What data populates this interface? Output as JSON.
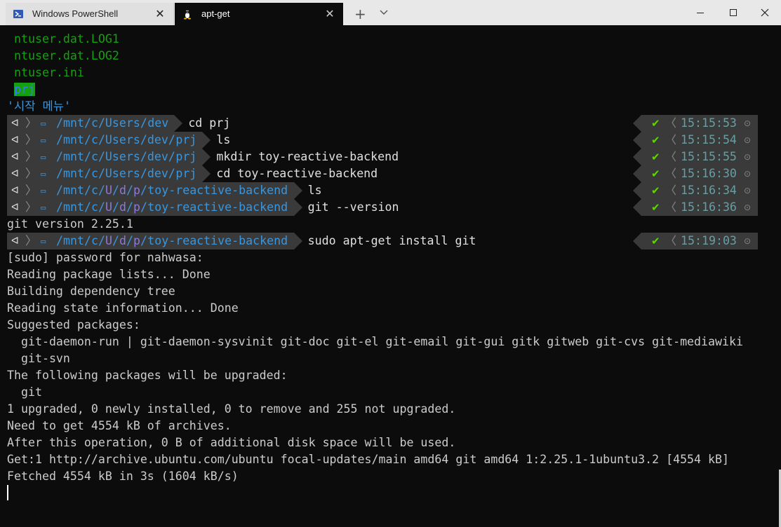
{
  "tabs": [
    {
      "label": "Windows PowerShell",
      "icon": "powershell-icon"
    },
    {
      "label": "apt-get",
      "icon": "linux-penguin-icon"
    }
  ],
  "window_controls": {
    "minimize": "–",
    "maximize": "☐",
    "close": "✕"
  },
  "listing": {
    "files": [
      "ntuser.dat.LOG1",
      "ntuser.dat.LOG2",
      "ntuser.ini"
    ],
    "dir": "prj",
    "korean": "'시작 메뉴'"
  },
  "prompts": [
    {
      "path_a": "/mnt/c/Users/",
      "path_b": "dev",
      "cmd": "cd prj",
      "time": "15:15:53"
    },
    {
      "path_a": "/mnt/c/Users/dev/",
      "path_b": "prj",
      "cmd": "ls",
      "time": "15:15:54"
    },
    {
      "path_a": "/mnt/c/Users/dev/",
      "path_b": "prj",
      "cmd": "mkdir toy-reactive-backend",
      "time": "15:15:55"
    },
    {
      "path_a": "/mnt/c/Users/dev/",
      "path_b": "prj",
      "cmd": "cd toy-reactive-backend",
      "time": "15:16:30"
    },
    {
      "path_a": "/mnt/c/U/d/p/",
      "path_b": "toy-reactive-backend",
      "cmd": "ls",
      "time": "15:16:34"
    },
    {
      "path_a": "/mnt/c/U/d/p/",
      "path_b": "toy-reactive-backend",
      "cmd": "git --version",
      "time": "15:16:36"
    },
    {
      "path_a": "/mnt/c/U/d/p/",
      "path_b": "toy-reactive-backend",
      "cmd": "sudo apt-get install git",
      "time": "15:19:03"
    }
  ],
  "git_version_output": "git version 2.25.1",
  "apt_output": [
    "[sudo] password for nahwasa:",
    "Reading package lists... Done",
    "Building dependency tree",
    "Reading state information... Done",
    "Suggested packages:",
    "  git-daemon-run | git-daemon-sysvinit git-doc git-el git-email git-gui gitk gitweb git-cvs git-mediawiki",
    "  git-svn",
    "The following packages will be upgraded:",
    "  git",
    "1 upgraded, 0 newly installed, 0 to remove and 255 not upgraded.",
    "Need to get 4554 kB of archives.",
    "After this operation, 0 B of additional disk space will be used.",
    "Get:1 http://archive.ubuntu.com/ubuntu focal-updates/main amd64 git amd64 1:2.25.1-1ubuntu3.2 [4554 kB]",
    "Fetched 4554 kB in 3s (1604 kB/s)"
  ],
  "prompt_symbols": {
    "apple": "ᐊ",
    "chev": "〉",
    "folder": "▭",
    "check": "✔",
    "rchev": "〈",
    "clock": "⊙"
  }
}
